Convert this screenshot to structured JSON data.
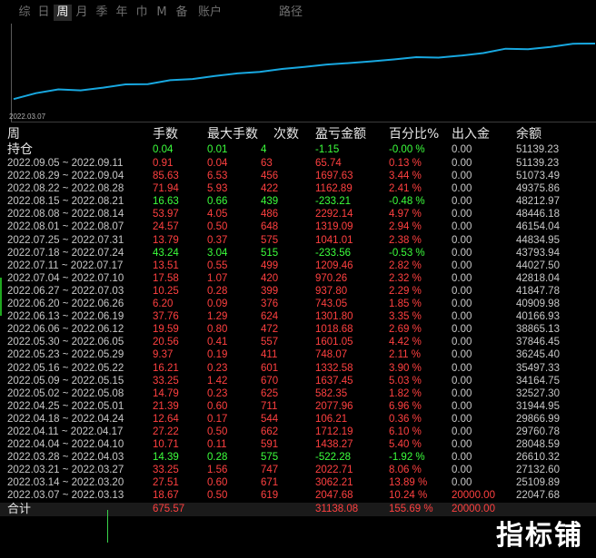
{
  "tabs": [
    {
      "label": "综",
      "active": false
    },
    {
      "label": "日",
      "active": false
    },
    {
      "label": "周",
      "active": true
    },
    {
      "label": "月",
      "active": false
    },
    {
      "label": "季",
      "active": false
    },
    {
      "label": "年",
      "active": false
    },
    {
      "label": "巾",
      "active": false
    },
    {
      "label": "M",
      "active": false
    },
    {
      "label": "备",
      "active": false
    },
    {
      "label": "账户",
      "active": false
    }
  ],
  "right_tab": "路径",
  "chart_data": {
    "type": "line",
    "x": [
      "2022.03.07",
      "2022.03.14",
      "2022.03.21",
      "2022.03.28",
      "2022.04.04",
      "2022.04.11",
      "2022.04.18",
      "2022.04.25",
      "2022.05.02",
      "2022.05.09",
      "2022.05.16",
      "2022.05.23",
      "2022.05.30",
      "2022.06.06",
      "2022.06.13",
      "2022.06.20",
      "2022.06.27",
      "2022.07.04",
      "2022.07.11",
      "2022.07.18",
      "2022.07.25",
      "2022.08.01",
      "2022.08.08",
      "2022.08.15",
      "2022.08.22",
      "2022.08.29",
      "2022.09.05"
    ],
    "series": [
      {
        "values": [
          22047.68,
          25109.89,
          27132.6,
          26610.32,
          28048.59,
          29760.78,
          29866.99,
          31944.95,
          32527.3,
          34164.75,
          35497.33,
          36245.4,
          37846.45,
          38865.13,
          40166.93,
          40909.98,
          41847.78,
          42818.04,
          44027.5,
          43793.94,
          44834.95,
          46154.04,
          48446.18,
          48212.97,
          49375.86,
          51073.49,
          51139.23
        ]
      }
    ],
    "tick_label": "2022.03.07",
    "line_color": "#18a8e0"
  },
  "columns": {
    "period": "周",
    "lots": "手数",
    "max_lots": "最大手数",
    "count": "次数",
    "pnl": "盈亏金额",
    "pct": "百分比%",
    "deposit": "出入金",
    "balance": "余额"
  },
  "holding": {
    "label": "持仓",
    "lots": "0.04",
    "max_lots": "0.01",
    "count": "4",
    "pnl": "-1.15",
    "pct": "-0.00 %",
    "deposit": "0.00",
    "balance": "51139.23"
  },
  "rows": [
    {
      "period": "2022.09.05 ~ 2022.09.11",
      "lots": "0.91",
      "max_lots": "0.04",
      "count": "63",
      "pnl": "65.74",
      "pct": "0.13 %",
      "deposit": "0.00",
      "balance": "51139.23",
      "sign": "pos"
    },
    {
      "period": "2022.08.29 ~ 2022.09.04",
      "lots": "85.63",
      "max_lots": "6.53",
      "count": "456",
      "pnl": "1697.63",
      "pct": "3.44 %",
      "deposit": "0.00",
      "balance": "51073.49",
      "sign": "pos"
    },
    {
      "period": "2022.08.22 ~ 2022.08.28",
      "lots": "71.94",
      "max_lots": "5.93",
      "count": "422",
      "pnl": "1162.89",
      "pct": "2.41 %",
      "deposit": "0.00",
      "balance": "49375.86",
      "sign": "pos"
    },
    {
      "period": "2022.08.15 ~ 2022.08.21",
      "lots": "16.63",
      "max_lots": "0.66",
      "count": "439",
      "pnl": "-233.21",
      "pct": "-0.48 %",
      "deposit": "0.00",
      "balance": "48212.97",
      "sign": "neg"
    },
    {
      "period": "2022.08.08 ~ 2022.08.14",
      "lots": "53.97",
      "max_lots": "4.05",
      "count": "486",
      "pnl": "2292.14",
      "pct": "4.97 %",
      "deposit": "0.00",
      "balance": "48446.18",
      "sign": "pos"
    },
    {
      "period": "2022.08.01 ~ 2022.08.07",
      "lots": "24.57",
      "max_lots": "0.50",
      "count": "648",
      "pnl": "1319.09",
      "pct": "2.94 %",
      "deposit": "0.00",
      "balance": "46154.04",
      "sign": "pos"
    },
    {
      "period": "2022.07.25 ~ 2022.07.31",
      "lots": "13.79",
      "max_lots": "0.37",
      "count": "575",
      "pnl": "1041.01",
      "pct": "2.38 %",
      "deposit": "0.00",
      "balance": "44834.95",
      "sign": "pos"
    },
    {
      "period": "2022.07.18 ~ 2022.07.24",
      "lots": "43.24",
      "max_lots": "3.04",
      "count": "515",
      "pnl": "-233.56",
      "pct": "-0.53 %",
      "deposit": "0.00",
      "balance": "43793.94",
      "sign": "neg"
    },
    {
      "period": "2022.07.11 ~ 2022.07.17",
      "lots": "13.51",
      "max_lots": "0.55",
      "count": "499",
      "pnl": "1209.46",
      "pct": "2.82 %",
      "deposit": "0.00",
      "balance": "44027.50",
      "sign": "pos"
    },
    {
      "period": "2022.07.04 ~ 2022.07.10",
      "lots": "17.58",
      "max_lots": "1.07",
      "count": "420",
      "pnl": "970.26",
      "pct": "2.32 %",
      "deposit": "0.00",
      "balance": "42818.04",
      "sign": "pos"
    },
    {
      "period": "2022.06.27 ~ 2022.07.03",
      "lots": "10.25",
      "max_lots": "0.28",
      "count": "399",
      "pnl": "937.80",
      "pct": "2.29 %",
      "deposit": "0.00",
      "balance": "41847.78",
      "sign": "pos"
    },
    {
      "period": "2022.06.20 ~ 2022.06.26",
      "lots": "6.20",
      "max_lots": "0.09",
      "count": "376",
      "pnl": "743.05",
      "pct": "1.85 %",
      "deposit": "0.00",
      "balance": "40909.98",
      "sign": "pos"
    },
    {
      "period": "2022.06.13 ~ 2022.06.19",
      "lots": "37.76",
      "max_lots": "1.29",
      "count": "624",
      "pnl": "1301.80",
      "pct": "3.35 %",
      "deposit": "0.00",
      "balance": "40166.93",
      "sign": "pos"
    },
    {
      "period": "2022.06.06 ~ 2022.06.12",
      "lots": "19.59",
      "max_lots": "0.80",
      "count": "472",
      "pnl": "1018.68",
      "pct": "2.69 %",
      "deposit": "0.00",
      "balance": "38865.13",
      "sign": "pos"
    },
    {
      "period": "2022.05.30 ~ 2022.06.05",
      "lots": "20.56",
      "max_lots": "0.41",
      "count": "557",
      "pnl": "1601.05",
      "pct": "4.42 %",
      "deposit": "0.00",
      "balance": "37846.45",
      "sign": "pos"
    },
    {
      "period": "2022.05.23 ~ 2022.05.29",
      "lots": "9.37",
      "max_lots": "0.19",
      "count": "411",
      "pnl": "748.07",
      "pct": "2.11 %",
      "deposit": "0.00",
      "balance": "36245.40",
      "sign": "pos"
    },
    {
      "period": "2022.05.16 ~ 2022.05.22",
      "lots": "16.21",
      "max_lots": "0.23",
      "count": "601",
      "pnl": "1332.58",
      "pct": "3.90 %",
      "deposit": "0.00",
      "balance": "35497.33",
      "sign": "pos"
    },
    {
      "period": "2022.05.09 ~ 2022.05.15",
      "lots": "33.25",
      "max_lots": "1.42",
      "count": "670",
      "pnl": "1637.45",
      "pct": "5.03 %",
      "deposit": "0.00",
      "balance": "34164.75",
      "sign": "pos"
    },
    {
      "period": "2022.05.02 ~ 2022.05.08",
      "lots": "14.79",
      "max_lots": "0.23",
      "count": "625",
      "pnl": "582.35",
      "pct": "1.82 %",
      "deposit": "0.00",
      "balance": "32527.30",
      "sign": "pos"
    },
    {
      "period": "2022.04.25 ~ 2022.05.01",
      "lots": "21.39",
      "max_lots": "0.60",
      "count": "711",
      "pnl": "2077.96",
      "pct": "6.96 %",
      "deposit": "0.00",
      "balance": "31944.95",
      "sign": "pos"
    },
    {
      "period": "2022.04.18 ~ 2022.04.24",
      "lots": "12.64",
      "max_lots": "0.17",
      "count": "544",
      "pnl": "106.21",
      "pct": "0.36 %",
      "deposit": "0.00",
      "balance": "29866.99",
      "sign": "pos"
    },
    {
      "period": "2022.04.11 ~ 2022.04.17",
      "lots": "27.22",
      "max_lots": "0.50",
      "count": "662",
      "pnl": "1712.19",
      "pct": "6.10 %",
      "deposit": "0.00",
      "balance": "29760.78",
      "sign": "pos"
    },
    {
      "period": "2022.04.04 ~ 2022.04.10",
      "lots": "10.71",
      "max_lots": "0.11",
      "count": "591",
      "pnl": "1438.27",
      "pct": "5.40 %",
      "deposit": "0.00",
      "balance": "28048.59",
      "sign": "pos"
    },
    {
      "period": "2022.03.28 ~ 2022.04.03",
      "lots": "14.39",
      "max_lots": "0.28",
      "count": "575",
      "pnl": "-522.28",
      "pct": "-1.92 %",
      "deposit": "0.00",
      "balance": "26610.32",
      "sign": "neg"
    },
    {
      "period": "2022.03.21 ~ 2022.03.27",
      "lots": "33.25",
      "max_lots": "1.56",
      "count": "747",
      "pnl": "2022.71",
      "pct": "8.06 %",
      "deposit": "0.00",
      "balance": "27132.60",
      "sign": "pos"
    },
    {
      "period": "2022.03.14 ~ 2022.03.20",
      "lots": "27.51",
      "max_lots": "0.60",
      "count": "671",
      "pnl": "3062.21",
      "pct": "13.89 %",
      "deposit": "0.00",
      "balance": "25109.89",
      "sign": "pos"
    },
    {
      "period": "2022.03.07 ~ 2022.03.13",
      "lots": "18.67",
      "max_lots": "0.50",
      "count": "619",
      "pnl": "2047.68",
      "pct": "10.24 %",
      "deposit": "20000.00",
      "balance": "22047.68",
      "sign": "pos"
    }
  ],
  "total": {
    "label": "合计",
    "lots": "675.57",
    "pnl": "31138.08",
    "pct": "155.69 %",
    "deposit": "20000.00"
  },
  "watermark": "指标铺",
  "colors": {
    "positive": "#ff4040",
    "negative": "#3cff3c",
    "neutral": "#c8c8c8",
    "line": "#18a8e0"
  }
}
